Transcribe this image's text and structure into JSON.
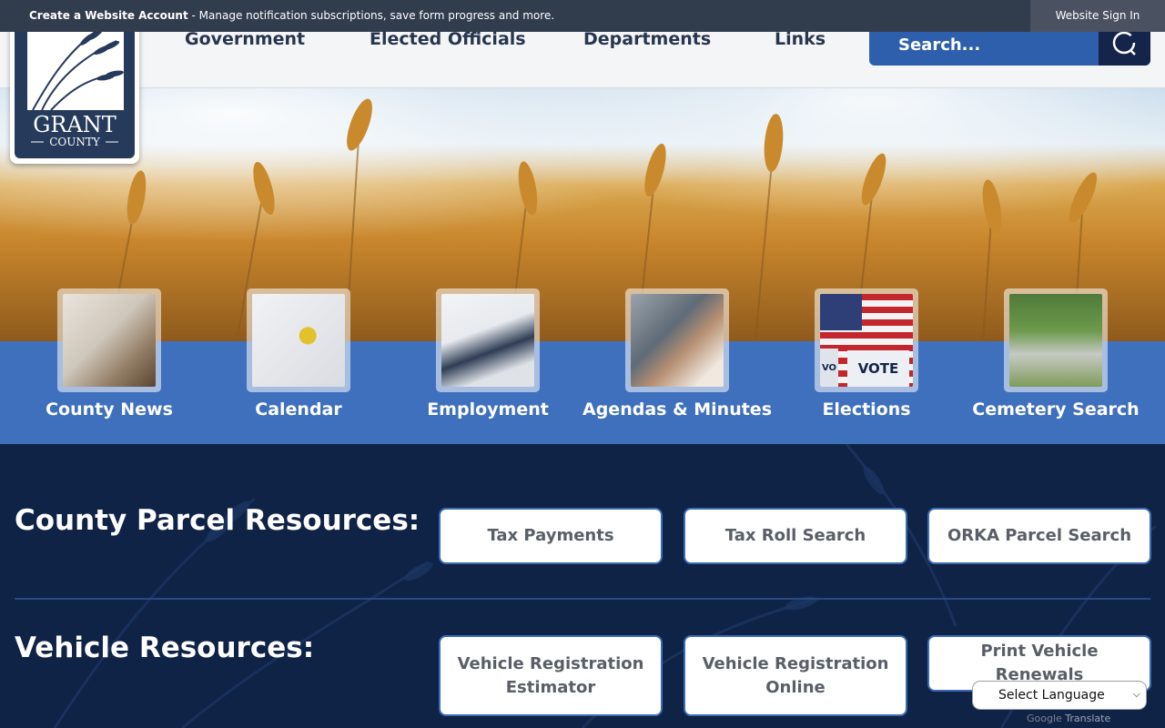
{
  "notice": {
    "bold": "Create a Website Account",
    "text": " - Manage notification subscriptions, save form progress and more.",
    "signin": "Website Sign In"
  },
  "logo": {
    "line1": "GRANT",
    "line2": "COUNTY"
  },
  "nav": {
    "items": [
      "Government",
      "Elected Officials",
      "Departments",
      "Links"
    ]
  },
  "search": {
    "placeholder": "Search..."
  },
  "quick_links": [
    "County News",
    "Calendar",
    "Employment",
    "Agendas & Minutes",
    "Elections",
    "Cemetery Search"
  ],
  "vote_sign": "VOTE",
  "vote_partial": "VO",
  "parcel": {
    "title": "County Parcel Resources:",
    "buttons": [
      "Tax Payments",
      "Tax Roll Search",
      "ORKA Parcel Search"
    ]
  },
  "vehicle": {
    "title": "Vehicle Resources:",
    "buttons": [
      [
        "Vehicle Registration",
        "Estimator"
      ],
      [
        "Vehicle Registration",
        "Online"
      ],
      [
        "Print Vehicle Renewals"
      ]
    ]
  },
  "translate": {
    "select": "Select Language",
    "google": "Google",
    "word": "Translate"
  },
  "colors": {
    "header_bar": "#313c4d",
    "band": "#3f70bd",
    "navy": "#0f2347",
    "search": "#2d5fad"
  }
}
